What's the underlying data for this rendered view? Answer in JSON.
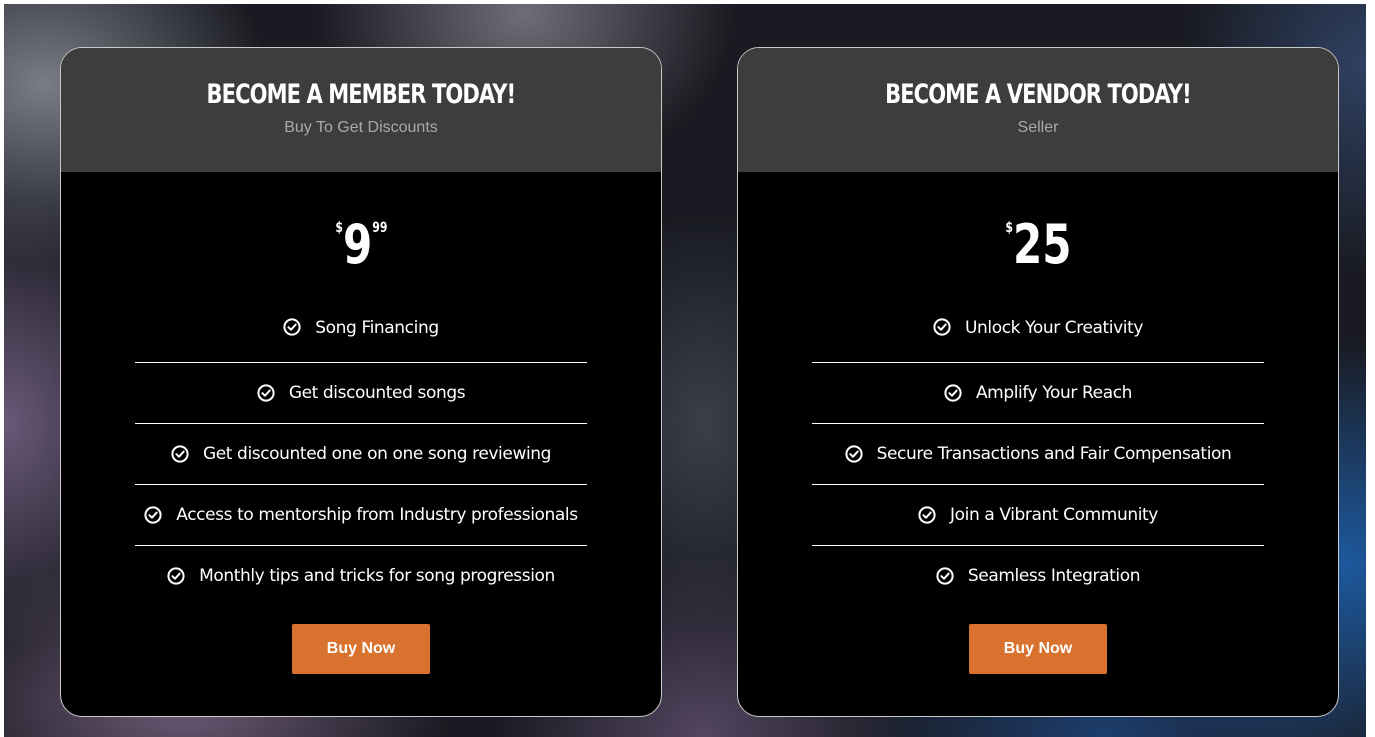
{
  "colors": {
    "card_background": "#000000",
    "header_background": "#3d3d3d",
    "subtitle_text": "#a9a9a9",
    "accent_button": "#d9722e",
    "text": "#ffffff"
  },
  "plans": {
    "member": {
      "title": "BECOME A MEMBER TODAY!",
      "subtitle": "Buy To Get Discounts",
      "price": {
        "currency": "$",
        "amount": "9",
        "cents": "99"
      },
      "features": [
        {
          "label": "Song Financing",
          "icon": "check-circle-icon"
        },
        {
          "label": "Get discounted songs",
          "icon": "check-circle-icon"
        },
        {
          "label": "Get discounted one on one song reviewing",
          "icon": "check-circle-icon"
        },
        {
          "label": "Access to mentorship from Industry professionals",
          "icon": "check-circle-icon"
        },
        {
          "label": "Monthly tips and tricks for song progression",
          "icon": "check-circle-icon"
        }
      ],
      "button_label": "Buy Now"
    },
    "vendor": {
      "title": "BECOME A VENDOR TODAY!",
      "subtitle": "Seller",
      "price": {
        "currency": "$",
        "amount": "25",
        "cents": ""
      },
      "features": [
        {
          "label": "Unlock Your Creativity",
          "icon": "check-circle-icon"
        },
        {
          "label": "Amplify Your Reach",
          "icon": "check-circle-icon"
        },
        {
          "label": "Secure Transactions and Fair Compensation",
          "icon": "check-circle-icon"
        },
        {
          "label": "Join a Vibrant Community",
          "icon": "check-circle-icon"
        },
        {
          "label": "Seamless Integration",
          "icon": "check-circle-icon"
        }
      ],
      "button_label": "Buy Now"
    }
  }
}
